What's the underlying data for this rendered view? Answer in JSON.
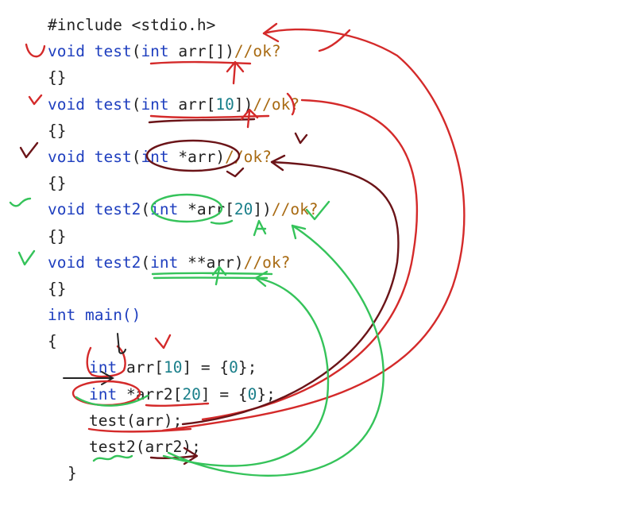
{
  "code": {
    "include": "#include <stdio.h>",
    "l1": {
      "kw": "void",
      "fn": "test",
      "pre": "(",
      "type": "int",
      "mid": " arr",
      "b1": "[",
      "num": "",
      "b2": "]",
      "close": ")",
      "comment": "//ok?"
    },
    "l3": {
      "kw": "void",
      "fn": "test",
      "pre": "(",
      "type": "int",
      "mid": " arr",
      "b1": "[",
      "num": "10",
      "b2": "]",
      "close": ")",
      "comment": "//ok?"
    },
    "l5": {
      "kw": "void",
      "fn": "test",
      "pre": "(",
      "type": "int",
      "mid": " *arr",
      "close": ")",
      "comment": "//ok?"
    },
    "l7": {
      "kw": "void",
      "fn": "test2",
      "pre": "(",
      "type": "int",
      "mid": " *arr",
      "b1": "[",
      "num": "20",
      "b2": "]",
      "close": ")",
      "comment": "//ok?"
    },
    "l9": {
      "kw": "void",
      "fn": "test2",
      "pre": "(",
      "type": "int",
      "mid": " **arr",
      "close": ")",
      "comment": "//ok?"
    },
    "brace_pair": "{}",
    "main_kw": "int",
    "main_sig": " main()",
    "open_brace": "{",
    "close_brace": "}",
    "decl1": {
      "type": "int",
      "name": " arr",
      "b1": "[",
      "num": "10",
      "b2": "]",
      "rest": " = {",
      "zero": "0",
      "end": "};"
    },
    "decl2": {
      "type": "int",
      "name": " *arr2",
      "b1": "[",
      "num": "20",
      "b2": "]",
      "rest": " = {",
      "zero": "0",
      "end": "};"
    },
    "call1": "test(arr);",
    "call2": "test2(arr2);"
  },
  "colors": {
    "keyword": "#1f3fbf",
    "number": "#1a7f8a",
    "comment": "#a86a12",
    "ink_red": "#d42a2a",
    "ink_dark_red": "#6b1418",
    "ink_green": "#35c35a"
  }
}
